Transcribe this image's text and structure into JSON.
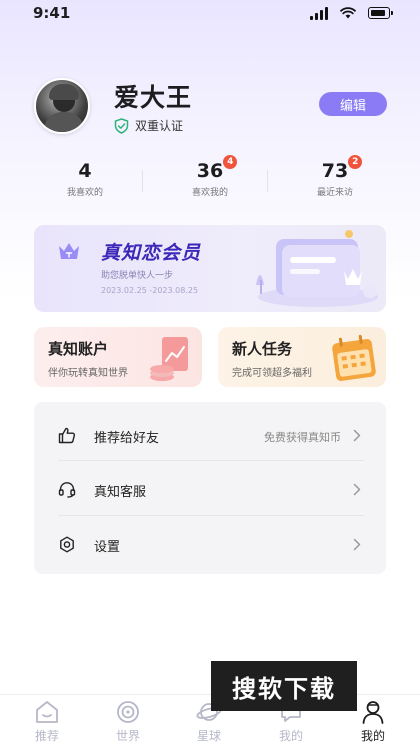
{
  "status_bar": {
    "time": "9:41"
  },
  "profile": {
    "name": "爱大王",
    "verify_label": "双重认证",
    "edit_label": "编辑"
  },
  "stats": [
    {
      "value": "4",
      "label": "我喜欢的",
      "badge": ""
    },
    {
      "value": "36",
      "label": "喜欢我的",
      "badge": "4"
    },
    {
      "value": "73",
      "label": "最近来访",
      "badge": "2"
    }
  ],
  "vip": {
    "title": "真知恋会员",
    "subtitle": "助您脱单快人一步",
    "dates": "2023.02.25 -2023.08.25"
  },
  "tasks": [
    {
      "title": "真知账户",
      "subtitle": "伴你玩转真知世界"
    },
    {
      "title": "新人任务",
      "subtitle": "完成可领超多福利"
    }
  ],
  "menu": [
    {
      "label": "推荐给好友",
      "extra": "免费获得真知币",
      "icon": "thumbs-up-icon"
    },
    {
      "label": "真知客服",
      "extra": "",
      "icon": "headset-icon"
    },
    {
      "label": "设置",
      "extra": "",
      "icon": "gear-icon"
    }
  ],
  "tabs": [
    {
      "label": "推荐",
      "icon": "home-icon",
      "active": false
    },
    {
      "label": "世界",
      "icon": "orbit-icon",
      "active": false
    },
    {
      "label": "星球",
      "icon": "planet-icon",
      "active": false
    },
    {
      "label": "我的",
      "icon": "chat-icon",
      "active": false
    },
    {
      "label": "我的",
      "icon": "user-icon",
      "active": true
    }
  ],
  "watermark": "搜软下载",
  "colors": {
    "accent": "#8b7cf6",
    "vip_title": "#3b27b8",
    "badge": "#f0543c",
    "verify_green": "#2fb37a"
  }
}
